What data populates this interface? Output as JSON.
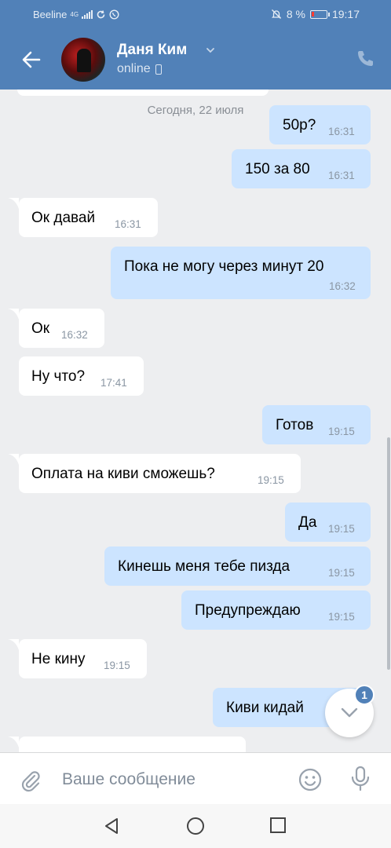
{
  "status_bar": {
    "carrier": "Beeline",
    "network": "4G",
    "battery": "8 %",
    "time": "19:17"
  },
  "header": {
    "contact_name": "Даня Ким",
    "presence": "online"
  },
  "chat": {
    "date_divider": "Сегодня, 22 июля",
    "messages": [
      {
        "dir": "out",
        "text": "50р?",
        "time": "16:31"
      },
      {
        "dir": "out",
        "text": "150 за 80",
        "time": "16:31"
      },
      {
        "dir": "in",
        "text": "Ок давай",
        "time": "16:31"
      },
      {
        "dir": "out",
        "text": "Пока не могу через минут 20",
        "time": "16:32"
      },
      {
        "dir": "in",
        "text": "Ок",
        "time": "16:32"
      },
      {
        "dir": "in",
        "text": "Ну что?",
        "time": "17:41"
      },
      {
        "dir": "out",
        "text": "Готов",
        "time": "19:15"
      },
      {
        "dir": "in",
        "text": "Оплата на киви сможешь?",
        "time": "19:15"
      },
      {
        "dir": "out",
        "text": "Да",
        "time": "19:15"
      },
      {
        "dir": "out",
        "text": "Кинешь меня тебе пизда",
        "time": "19:15"
      },
      {
        "dir": "out",
        "text": "Предупреждаю",
        "time": "19:15"
      },
      {
        "dir": "in",
        "text": "Не кину",
        "time": "19:15"
      },
      {
        "dir": "out",
        "text": "Киви кидай",
        "time": ""
      }
    ],
    "unread_badge": "1"
  },
  "composer": {
    "placeholder": "Ваше сообщение"
  },
  "icons": {
    "back": "arrow-left-icon",
    "call": "phone-icon",
    "attach": "paperclip-icon",
    "emoji": "smile-icon",
    "mic": "microphone-icon",
    "scroll_down": "chevron-down-icon"
  },
  "colors": {
    "header": "#5181b8",
    "outgoing": "#cce4ff",
    "incoming": "#ffffff",
    "background": "#edeef0"
  }
}
